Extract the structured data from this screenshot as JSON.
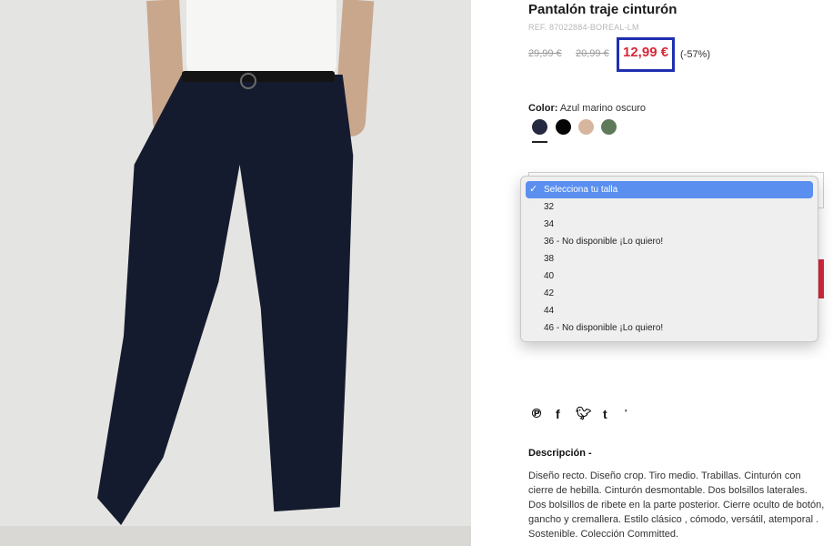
{
  "product": {
    "title": "Pantalón traje cinturón",
    "ref": "REF. 87022884-BOREAL-LM",
    "prices": {
      "original": "29,99 €",
      "previous": "20,99 €",
      "current": "12,99 €",
      "discount": "(-57%)"
    },
    "color": {
      "label": "Color:",
      "value": "Azul marino oscuro",
      "swatches": [
        {
          "name": "navy",
          "hex": "#252a40",
          "selected": true
        },
        {
          "name": "black",
          "hex": "#050505"
        },
        {
          "name": "beige",
          "hex": "#d7b6a0"
        },
        {
          "name": "green",
          "hex": "#5e7a5a"
        }
      ]
    },
    "size_select": {
      "options": [
        "Selecciona tu talla",
        "32",
        "34",
        "36 - No disponible ¡Lo quiero!",
        "38",
        "40",
        "42",
        "44",
        "46 - No disponible ¡Lo quiero!"
      ],
      "selected": "Selecciona tu talla"
    },
    "share_icons": [
      "pinterest-icon",
      "facebook-icon",
      "twitter-icon",
      "tumblr-icon",
      "more-icon"
    ],
    "description": {
      "heading": "Descripción -",
      "text": "Diseño recto. Diseño crop. Tiro medio. Trabillas. Cinturón con cierre de hebilla. Cinturón desmontable. Dos bolsillos laterales. Dos bolsillos de ribete en la parte posterior. Cierre oculto de botón, gancho y cremallera. Estilo clásico , cómodo, versátil, atemporal . Sostenible. Colección Committed."
    }
  },
  "colors": {
    "price_red": "#d8283a",
    "highlight_blue": "#1f2fb0",
    "menu_selected": "#5a8ff0"
  }
}
